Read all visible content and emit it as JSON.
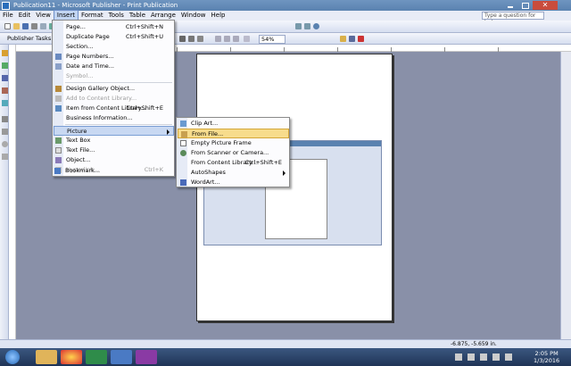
{
  "window": {
    "title": "Publication11 - Microsoft Publisher - Print Publication",
    "close_glyph": "✕"
  },
  "menubar": {
    "items": [
      {
        "label": "File"
      },
      {
        "label": "Edit"
      },
      {
        "label": "View"
      },
      {
        "label": "Insert"
      },
      {
        "label": "Format"
      },
      {
        "label": "Tools"
      },
      {
        "label": "Table"
      },
      {
        "label": "Arrange"
      },
      {
        "label": "Window"
      },
      {
        "label": "Help"
      }
    ],
    "help_placeholder": "Type a question for help"
  },
  "toolbar": {
    "publisher_tasks": "Publisher Tasks",
    "zoom": "54%"
  },
  "insert_menu": {
    "items": [
      {
        "label": "Page...",
        "shortcut": "Ctrl+Shift+N"
      },
      {
        "label": "Duplicate Page",
        "shortcut": "Ctrl+Shift+U"
      },
      {
        "label": "Section...",
        "shortcut": ""
      },
      {
        "label": "Page Numbers...",
        "shortcut": ""
      },
      {
        "label": "Date and Time...",
        "shortcut": ""
      },
      {
        "label": "Symbol...",
        "shortcut": ""
      },
      {
        "label": "Design Gallery Object...",
        "shortcut": ""
      },
      {
        "label": "Add to Content Library...",
        "shortcut": ""
      },
      {
        "label": "Item from Content Library...",
        "shortcut": "Ctrl+Shift+E"
      },
      {
        "label": "Business Information...",
        "shortcut": ""
      },
      {
        "label": "Picture",
        "shortcut": ""
      },
      {
        "label": "Text Box",
        "shortcut": ""
      },
      {
        "label": "Text File...",
        "shortcut": ""
      },
      {
        "label": "Object...",
        "shortcut": ""
      },
      {
        "label": "Hyperlink...",
        "shortcut": "Ctrl+K"
      },
      {
        "label": "Bookmark...",
        "shortcut": ""
      }
    ]
  },
  "picture_menu": {
    "items": [
      {
        "label": "Clip Art...",
        "shortcut": ""
      },
      {
        "label": "From File...",
        "shortcut": ""
      },
      {
        "label": "Empty Picture Frame",
        "shortcut": ""
      },
      {
        "label": "From Scanner or Camera...",
        "shortcut": ""
      },
      {
        "label": "From Content Library...",
        "shortcut": "Ctrl+Shift+E"
      },
      {
        "label": "AutoShapes",
        "shortcut": ""
      },
      {
        "label": "WordArt...",
        "shortcut": ""
      }
    ]
  },
  "statusbar": {
    "coordinates": "-6.875, -5.659 in."
  },
  "taskbar": {
    "time": "2:05 PM",
    "date": "1/3/2016"
  },
  "colors": {
    "accent": "#5a82b0",
    "menu_highlight": "#c8d8f2",
    "submenu_highlight": "#f7dc8c",
    "workspace": "#8990a8"
  }
}
